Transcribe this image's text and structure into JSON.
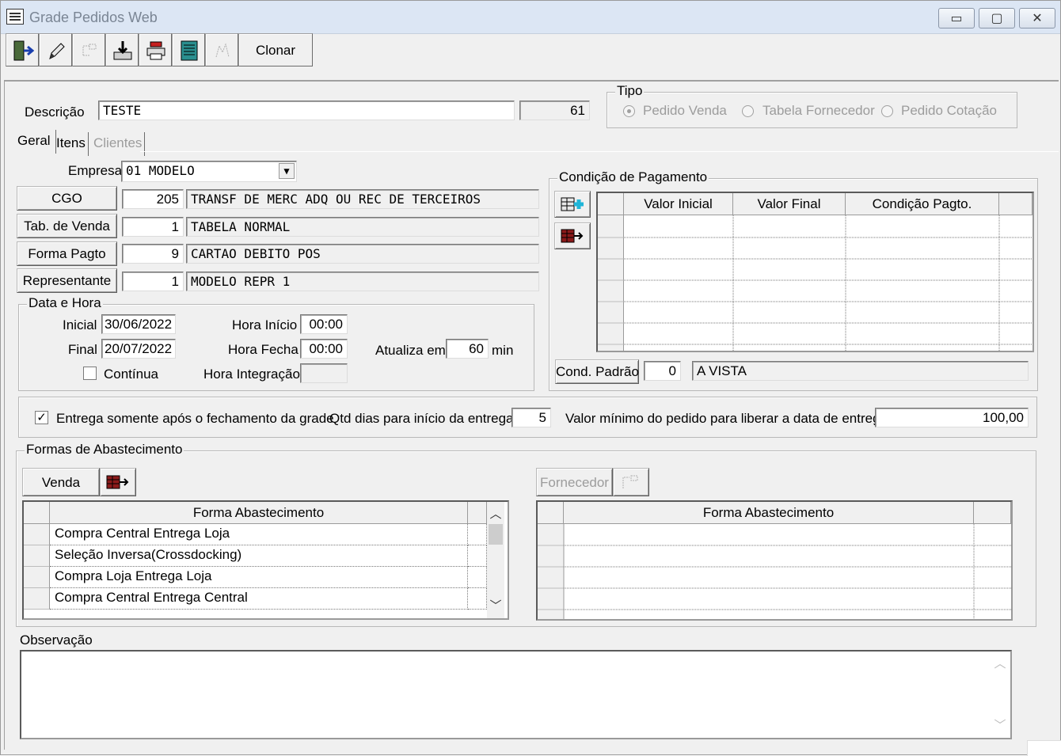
{
  "window": {
    "title": "Grade Pedidos Web",
    "buttons": [
      "▭",
      "▢",
      "✕"
    ]
  },
  "toolbar": {
    "clone_label": "Clonar"
  },
  "header": {
    "descricao_label": "Descrição",
    "descricao_value": "TESTE",
    "code": "61"
  },
  "tipo": {
    "title": "Tipo",
    "options": [
      "Pedido Venda",
      "Tabela Fornecedor",
      "Pedido Cotação"
    ],
    "selected": "Pedido Venda"
  },
  "tabs": [
    "Geral",
    "Itens",
    "Clientes"
  ],
  "empresa": {
    "label": "Empresa",
    "value": "01 MODELO"
  },
  "lookups": [
    {
      "button": "CGO",
      "code": "205",
      "desc": "TRANSF DE MERC ADQ OU REC DE TERCEIROS"
    },
    {
      "button": "Tab. de Venda",
      "code": "1",
      "desc": "TABELA NORMAL"
    },
    {
      "button": "Forma Pagto",
      "code": "9",
      "desc": "CARTAO DEBITO POS"
    },
    {
      "button": "Representante",
      "code": "1",
      "desc": "MODELO REPR 1"
    }
  ],
  "data_hora": {
    "title": "Data e Hora",
    "inicial_label": "Inicial",
    "inicial": "30/06/2022",
    "final_label": "Final",
    "final": "20/07/2022",
    "continua_label": "Contínua",
    "hora_inicio_label": "Hora Início",
    "hora_inicio": "00:00",
    "hora_fecha_label": "Hora Fecha",
    "hora_fecha": "00:00",
    "hora_integracao_label": "Hora Integração",
    "hora_integracao": "",
    "atualiza_label": "Atualiza em",
    "atualiza": "60",
    "min_label": "min"
  },
  "condicao": {
    "title": "Condição de Pagamento",
    "columns": [
      "Valor Inicial",
      "Valor Final",
      "Condição Pagto."
    ],
    "padrao_button": "Cond. Padrão",
    "padrao_code": "0",
    "padrao_desc": "A VISTA"
  },
  "entrega": {
    "checkbox_label": "Entrega somente após o fechamento da grade",
    "checked": true,
    "qtd_label": "Qtd dias para início da entrega",
    "qtd": "5",
    "valor_label": "Valor mínimo do pedido para liberar a data de entrega",
    "valor": "100,00"
  },
  "abastecimento": {
    "title": "Formas de Abastecimento",
    "venda_button": "Venda",
    "fornecedor_button": "Fornecedor",
    "column": "Forma Abastecimento",
    "rows": [
      "Compra Central Entrega Loja",
      "Seleção Inversa(Crossdocking)",
      "Compra Loja Entrega Loja",
      "Compra Central Entrega Central"
    ]
  },
  "observacao": {
    "label": "Observação"
  }
}
